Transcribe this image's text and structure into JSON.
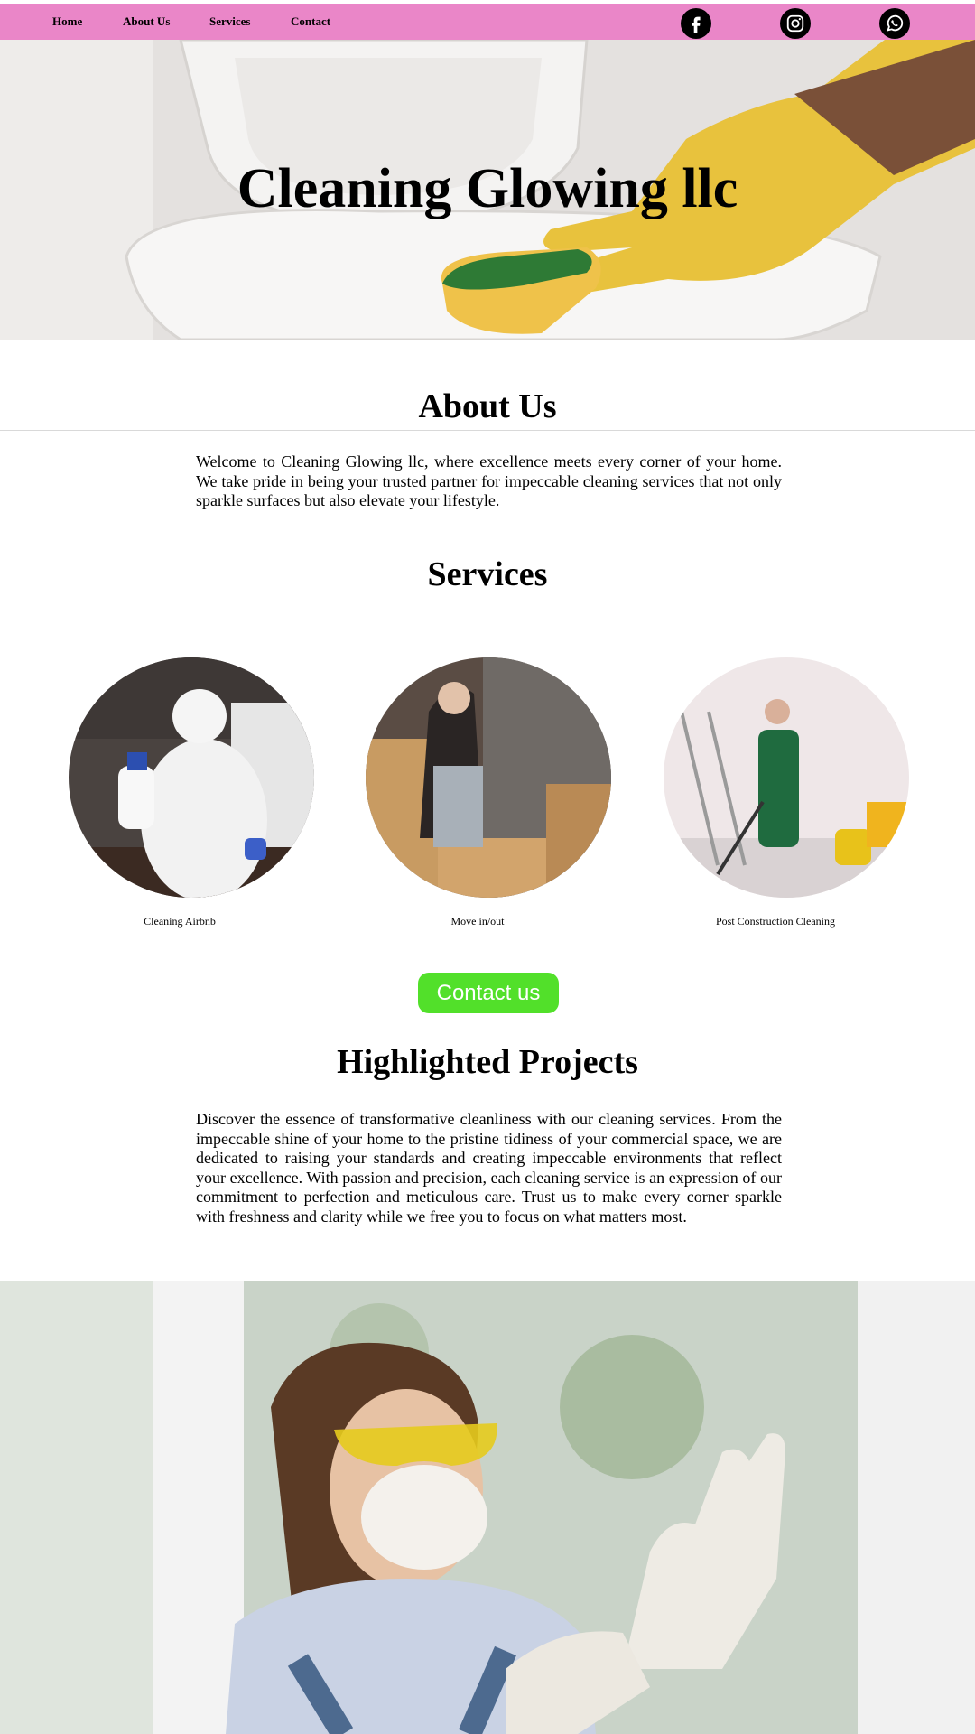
{
  "nav": {
    "links": [
      "Home",
      "About Us",
      "Services",
      "Contact"
    ],
    "social": [
      "facebook-icon",
      "instagram-icon",
      "whatsapp-icon"
    ],
    "bg_color": "#ea86c8"
  },
  "hero": {
    "title": "Cleaning Glowing llc"
  },
  "about": {
    "heading": "About Us",
    "text": "Welcome to Cleaning Glowing llc, where excellence meets every corner of your home. We take pride in being your trusted partner for impeccable cleaning services that not only sparkle surfaces but also elevate your lifestyle."
  },
  "services": {
    "heading": "Services",
    "items": [
      {
        "label": "Cleaning Airbnb"
      },
      {
        "label": "Move in/out"
      },
      {
        "label": "Post Construction Cleaning"
      }
    ]
  },
  "contact_button": {
    "label": "Contact us",
    "color": "#52e02a"
  },
  "projects": {
    "heading": "Highlighted Projects",
    "text": "Discover the essence of transformative cleanliness with our cleaning services. From the impeccable shine of your home to the pristine tidiness of your commercial space, we are dedicated to raising your standards and creating impeccable environments that reflect your excellence. With passion and precision, each cleaning service is an expression of our commitment to perfection and meticulous care. Trust us to make every corner sparkle with freshness and clarity while we free you to focus on what matters most."
  }
}
